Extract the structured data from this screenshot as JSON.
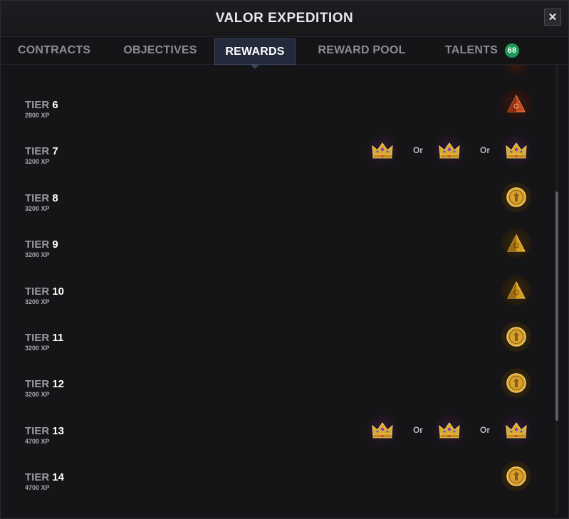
{
  "window": {
    "title": "VALOR EXPEDITION",
    "close_label": "✕"
  },
  "tabs": [
    {
      "label": "CONTRACTS",
      "active": false
    },
    {
      "label": "OBJECTIVES",
      "active": false
    },
    {
      "label": "REWARDS",
      "active": true
    },
    {
      "label": "REWARD POOL",
      "active": false
    },
    {
      "label": "TALENTS",
      "active": false,
      "badge": "68"
    }
  ],
  "or_label": "Or",
  "tiers": [
    {
      "prefix": "TIER",
      "number": "6",
      "xp": "2800 XP",
      "rewards": [
        "pyramid-red-icon"
      ]
    },
    {
      "prefix": "TIER",
      "number": "7",
      "xp": "3200 XP",
      "rewards": [
        "crown-icon",
        "crown-icon",
        "crown-icon"
      ]
    },
    {
      "prefix": "TIER",
      "number": "8",
      "xp": "3200 XP",
      "rewards": [
        "coin-icon"
      ]
    },
    {
      "prefix": "TIER",
      "number": "9",
      "xp": "3200 XP",
      "rewards": [
        "pyramid-gold-icon"
      ]
    },
    {
      "prefix": "TIER",
      "number": "10",
      "xp": "3200 XP",
      "rewards": [
        "pyramid-gold-icon"
      ]
    },
    {
      "prefix": "TIER",
      "number": "11",
      "xp": "3200 XP",
      "rewards": [
        "coin-icon"
      ]
    },
    {
      "prefix": "TIER",
      "number": "12",
      "xp": "3200 XP",
      "rewards": [
        "coin-icon"
      ]
    },
    {
      "prefix": "TIER",
      "number": "13",
      "xp": "4700 XP",
      "rewards": [
        "crown-icon",
        "crown-icon",
        "crown-icon"
      ]
    },
    {
      "prefix": "TIER",
      "number": "14",
      "xp": "4700 XP",
      "rewards": [
        "coin-icon"
      ]
    }
  ],
  "colors": {
    "background": "#151517",
    "active_tab": "#232a3c",
    "badge": "#1f9a55",
    "tier_number": "#ffffff",
    "tier_prefix": "#9a9ca2"
  }
}
